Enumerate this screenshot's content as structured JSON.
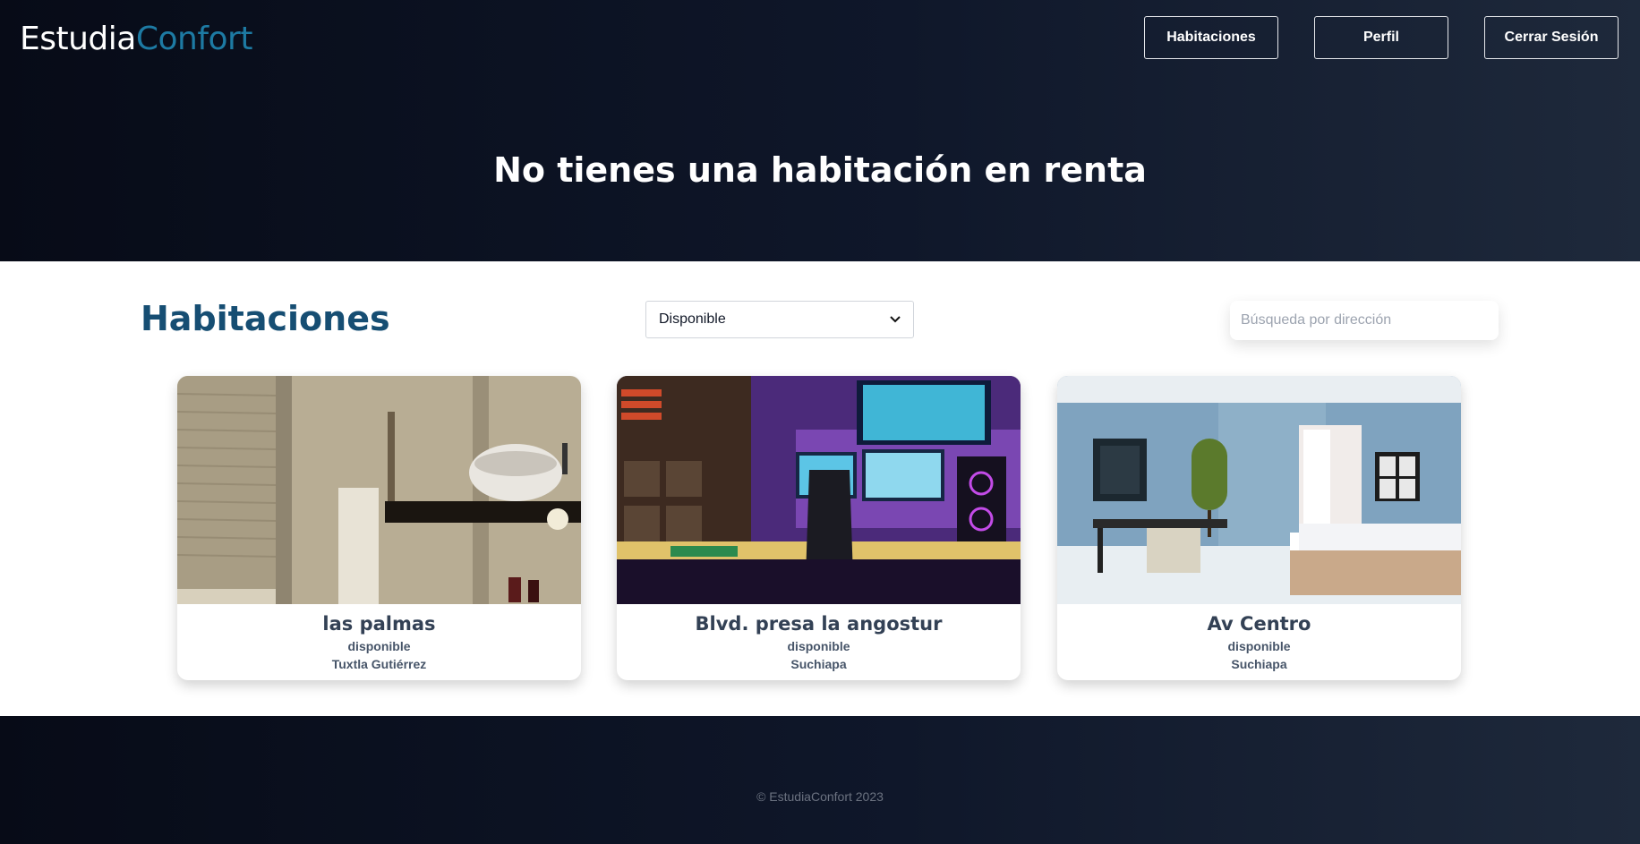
{
  "brand": {
    "part1": "Estudia",
    "part2": "Confort"
  },
  "nav": {
    "habitaciones": "Habitaciones",
    "perfil": "Perfil",
    "logout": "Cerrar Sesión"
  },
  "hero": {
    "title": "No tienes una habitación en renta"
  },
  "main": {
    "title": "Habitaciones",
    "filter": {
      "selected": "Disponible"
    },
    "search": {
      "placeholder": "Búsqueda por dirección",
      "value": ""
    }
  },
  "rooms": [
    {
      "name": "las palmas",
      "status": "disponible",
      "city": "Tuxtla Gutiérrez",
      "image": "bathroom-photo"
    },
    {
      "name": "Blvd. presa la angostur",
      "status": "disponible",
      "city": "Suchiapa",
      "image": "gaming-room-photo"
    },
    {
      "name": "Av Centro",
      "status": "disponible",
      "city": "Suchiapa",
      "image": "bedroom-photo"
    }
  ],
  "footer": {
    "text": "© EstudiaConfort 2023"
  },
  "colors": {
    "brand_accent": "#1d7aa3",
    "title": "#164e73",
    "dark_bg": "#0f172a"
  }
}
